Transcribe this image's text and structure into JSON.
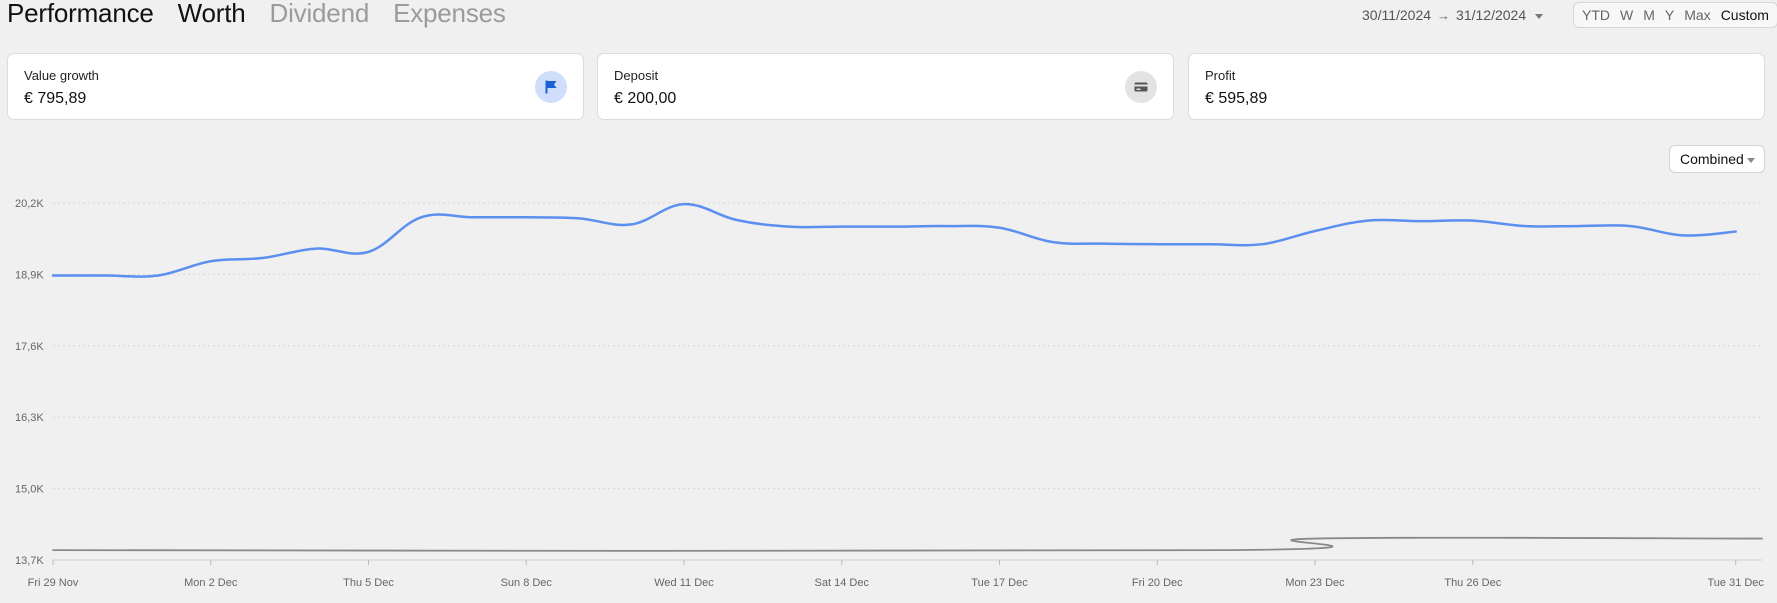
{
  "tabs": [
    {
      "label": "Performance",
      "active": false
    },
    {
      "label": "Worth",
      "active": true
    },
    {
      "label": "Dividend",
      "active": false
    },
    {
      "label": "Expenses",
      "active": false
    }
  ],
  "date_range": {
    "start": "30/11/2024",
    "arrow": "→",
    "end": "31/12/2024"
  },
  "periods": [
    {
      "label": "YTD",
      "active": false
    },
    {
      "label": "W",
      "active": false
    },
    {
      "label": "M",
      "active": false
    },
    {
      "label": "Y",
      "active": false
    },
    {
      "label": "Max",
      "active": false
    },
    {
      "label": "Custom",
      "active": true
    }
  ],
  "cards": [
    {
      "label": "Value growth",
      "value": "€ 795,89",
      "icon": "flag-icon"
    },
    {
      "label": "Deposit",
      "value": "€ 200,00",
      "icon": "credit-card-icon"
    },
    {
      "label": "Profit",
      "value": "€ 595,89",
      "icon": ""
    }
  ],
  "view_select": {
    "value": "Combined"
  },
  "colors": {
    "worth_line": "#5b8ff0",
    "deposit_line": "#8a8a8a",
    "flag_icon": "#1f5fd6"
  },
  "chart_data": {
    "type": "line",
    "y_ticks": [
      "20,2K",
      "18,9K",
      "17,6K",
      "16,3K",
      "15,0K",
      "13,7K"
    ],
    "y_tick_values": [
      20200,
      18900,
      17600,
      16300,
      15000,
      13700
    ],
    "ylim": [
      13700,
      20200
    ],
    "x_ticks": [
      {
        "day": 0,
        "label": "Fri 29 Nov"
      },
      {
        "day": 3,
        "label": "Mon 2 Dec"
      },
      {
        "day": 6,
        "label": "Thu 5 Dec"
      },
      {
        "day": 9,
        "label": "Sun 8 Dec"
      },
      {
        "day": 12,
        "label": "Wed 11 Dec"
      },
      {
        "day": 15,
        "label": "Sat 14 Dec"
      },
      {
        "day": 18,
        "label": "Tue 17 Dec"
      },
      {
        "day": 21,
        "label": "Fri 20 Dec"
      },
      {
        "day": 24,
        "label": "Mon 23 Dec"
      },
      {
        "day": 27,
        "label": "Thu 26 Dec"
      },
      {
        "day": 32,
        "label": "Tue 31 Dec"
      }
    ],
    "x_range_days": [
      0,
      32.5
    ],
    "grid": "horizontal-dotted",
    "series": [
      {
        "values": [
          [
            0,
            18880
          ],
          [
            1,
            18880
          ],
          [
            2,
            18880
          ],
          [
            3,
            19140
          ],
          [
            4,
            19200
          ],
          [
            5,
            19370
          ],
          [
            6,
            19310
          ],
          [
            7,
            19940
          ],
          [
            8,
            19940
          ],
          [
            9,
            19940
          ],
          [
            10,
            19920
          ],
          [
            11,
            19810
          ],
          [
            12,
            20180
          ],
          [
            13,
            19890
          ],
          [
            14,
            19770
          ],
          [
            15,
            19770
          ],
          [
            16,
            19770
          ],
          [
            17,
            19780
          ],
          [
            18,
            19750
          ],
          [
            19,
            19490
          ],
          [
            20,
            19460
          ],
          [
            21,
            19450
          ],
          [
            22,
            19450
          ],
          [
            23,
            19450
          ],
          [
            24,
            19690
          ],
          [
            25,
            19880
          ],
          [
            26,
            19870
          ],
          [
            27,
            19880
          ],
          [
            28,
            19780
          ],
          [
            29,
            19780
          ],
          [
            30,
            19780
          ],
          [
            31,
            19610
          ],
          [
            32,
            19680
          ]
        ]
      },
      {
        "values": [
          [
            0,
            13880
          ],
          [
            22.4,
            13880
          ],
          [
            24,
            14090
          ],
          [
            32.5,
            14090
          ]
        ]
      }
    ]
  }
}
